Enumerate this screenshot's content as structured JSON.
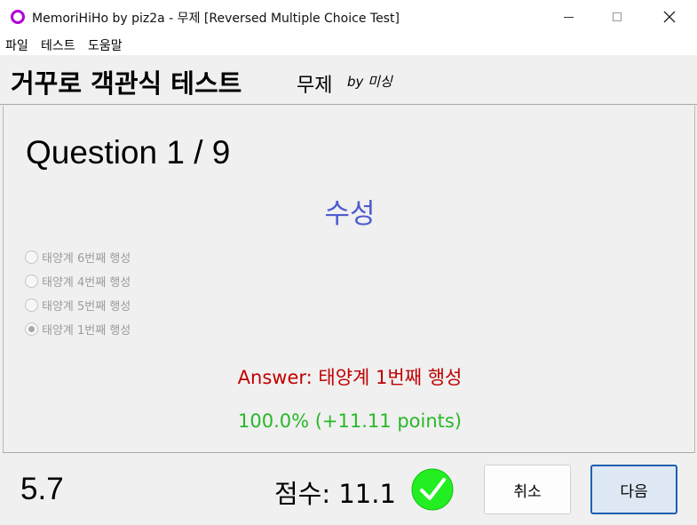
{
  "window": {
    "title": "MemoriHiHo by piz2a - 무제 [Reversed Multiple Choice Test]"
  },
  "menu": {
    "items": [
      "파일",
      "테스트",
      "도움말"
    ]
  },
  "header": {
    "title": "거꾸로 객관식 테스트",
    "subject": "무제",
    "by": "by 미싱"
  },
  "question": {
    "counter": "Question 1 / 9",
    "word": "수성",
    "choices": [
      {
        "label": "태양계 6번째 행성",
        "checked": false
      },
      {
        "label": "태양계 4번째 행성",
        "checked": false
      },
      {
        "label": "태양계 5번째 행성",
        "checked": false
      },
      {
        "label": "태양계 1번째 행성",
        "checked": true
      }
    ],
    "answer": "Answer: 태양계 1번째 행성",
    "result": "100.0% (+11.11 points)"
  },
  "footer": {
    "timer": "5.7",
    "score": "점수: 11.1",
    "cancel_label": "취소",
    "next_label": "다음"
  },
  "colors": {
    "question_word": "#4f5bd0",
    "answer": "#c00000",
    "result": "#28b828",
    "check": "#22ee22",
    "accent": "#1f5fae"
  }
}
